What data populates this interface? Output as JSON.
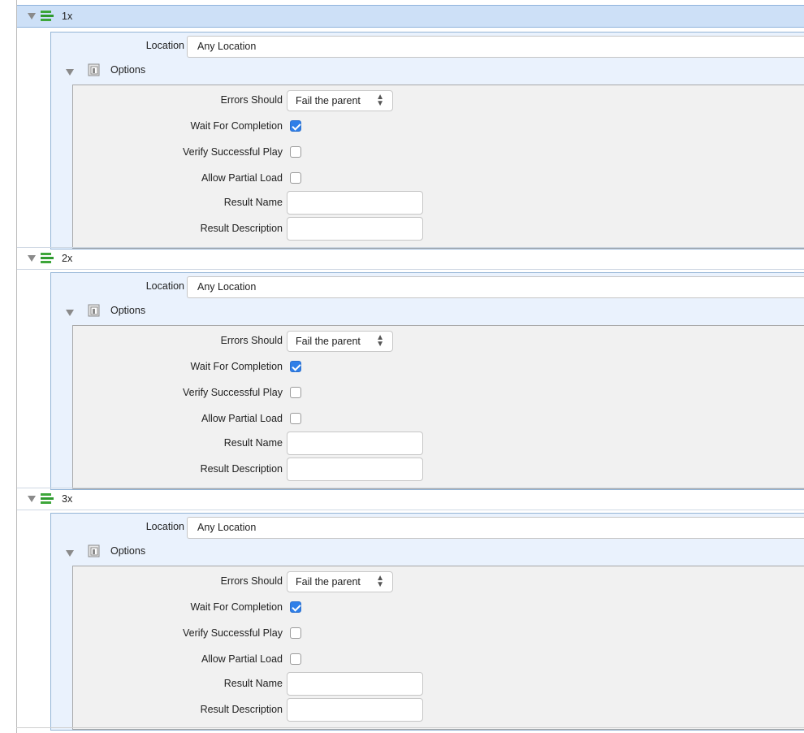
{
  "groups": [
    {
      "title": "1x",
      "selected": true,
      "location_label": "Location",
      "location_value": "Any Location",
      "options_label": "Options",
      "fields": {
        "errors_label": "Errors Should",
        "errors_value": "Fail the parent",
        "wait_label": "Wait For Completion",
        "wait_checked": true,
        "verify_label": "Verify Successful Play",
        "verify_checked": false,
        "partial_label": "Allow Partial Load",
        "partial_checked": false,
        "result_name_label": "Result Name",
        "result_name_value": "",
        "result_desc_label": "Result Description",
        "result_desc_value": ""
      }
    },
    {
      "title": "2x",
      "selected": false,
      "location_label": "Location",
      "location_value": "Any Location",
      "options_label": "Options",
      "fields": {
        "errors_label": "Errors Should",
        "errors_value": "Fail the parent",
        "wait_label": "Wait For Completion",
        "wait_checked": true,
        "verify_label": "Verify Successful Play",
        "verify_checked": false,
        "partial_label": "Allow Partial Load",
        "partial_checked": false,
        "result_name_label": "Result Name",
        "result_name_value": "",
        "result_desc_label": "Result Description",
        "result_desc_value": ""
      }
    },
    {
      "title": "3x",
      "selected": false,
      "location_label": "Location",
      "location_value": "Any Location",
      "options_label": "Options",
      "fields": {
        "errors_label": "Errors Should",
        "errors_value": "Fail the parent",
        "wait_label": "Wait For Completion",
        "wait_checked": true,
        "verify_label": "Verify Successful Play",
        "verify_checked": false,
        "partial_label": "Allow Partial Load",
        "partial_checked": false,
        "result_name_label": "Result Name",
        "result_name_value": "",
        "result_desc_label": "Result Description",
        "result_desc_value": ""
      }
    }
  ],
  "icons": {
    "disclosure": "disclosure-triangle-icon",
    "group": "stack-layers-icon",
    "options": "options-panel-icon",
    "select_arrows": "up-down-arrows-icon"
  },
  "colors": {
    "selected_header": "#cde0f7",
    "panel_background": "#eaf2fd",
    "inner_background": "#f1f1f1",
    "checkbox_on": "#2f7fe8",
    "stack_icon": "#3da63a"
  }
}
